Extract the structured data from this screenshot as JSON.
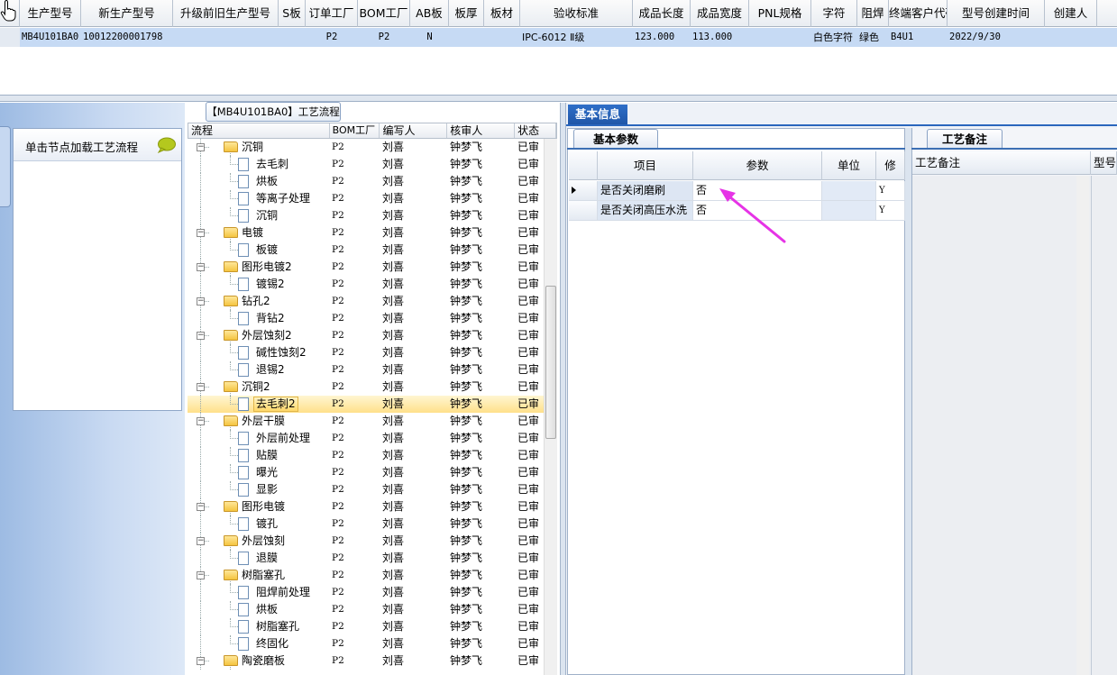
{
  "top_grid": {
    "headers": [
      "生产型号",
      "新生产型号",
      "升级前旧生产型号",
      "S板",
      "订单工厂",
      "BOM工厂",
      "AB板",
      "板厚",
      "板材",
      "验收标准",
      "成品长度",
      "成品宽度",
      "PNL规格",
      "字符",
      "阻焊",
      "终端客户代码",
      "型号创建时间",
      "创建人"
    ],
    "row": [
      "MB4U101BA0",
      "10012200001798",
      "",
      "",
      "P2",
      "P2",
      "N",
      "",
      "",
      "IPC-6012 Ⅱ级",
      "123.000",
      "113.000",
      "",
      "白色字符",
      "绿色",
      "B4U1",
      "2022/9/30",
      ""
    ]
  },
  "left_panel": {
    "node_hint": "单击节点加载工艺流程"
  },
  "flow": {
    "title": "【MB4U101BA0】工艺流程",
    "columns": [
      "流程",
      "BOM工厂",
      "编写人",
      "核审人",
      "状态"
    ],
    "rows": [
      {
        "level": 0,
        "type": "folder",
        "name": "沉铜",
        "bom": "P2",
        "writer": "刘喜",
        "reviewer": "钟梦飞",
        "status": "已审"
      },
      {
        "level": 1,
        "type": "doc",
        "name": "去毛刺",
        "bom": "P2",
        "writer": "刘喜",
        "reviewer": "钟梦飞",
        "status": "已审"
      },
      {
        "level": 1,
        "type": "doc",
        "name": "烘板",
        "bom": "P2",
        "writer": "刘喜",
        "reviewer": "钟梦飞",
        "status": "已审"
      },
      {
        "level": 1,
        "type": "doc",
        "name": "等离子处理",
        "bom": "P2",
        "writer": "刘喜",
        "reviewer": "钟梦飞",
        "status": "已审"
      },
      {
        "level": 1,
        "type": "doc",
        "name": "沉铜",
        "bom": "P2",
        "writer": "刘喜",
        "reviewer": "钟梦飞",
        "status": "已审"
      },
      {
        "level": 0,
        "type": "folder",
        "name": "电镀",
        "bom": "P2",
        "writer": "刘喜",
        "reviewer": "钟梦飞",
        "status": "已审"
      },
      {
        "level": 1,
        "type": "doc",
        "name": "板镀",
        "bom": "P2",
        "writer": "刘喜",
        "reviewer": "钟梦飞",
        "status": "已审"
      },
      {
        "level": 0,
        "type": "folder",
        "name": "图形电镀2",
        "bom": "P2",
        "writer": "刘喜",
        "reviewer": "钟梦飞",
        "status": "已审"
      },
      {
        "level": 1,
        "type": "doc",
        "name": "镀锡2",
        "bom": "P2",
        "writer": "刘喜",
        "reviewer": "钟梦飞",
        "status": "已审"
      },
      {
        "level": 0,
        "type": "folder",
        "name": "钻孔2",
        "bom": "P2",
        "writer": "刘喜",
        "reviewer": "钟梦飞",
        "status": "已审"
      },
      {
        "level": 1,
        "type": "doc",
        "name": "背钻2",
        "bom": "P2",
        "writer": "刘喜",
        "reviewer": "钟梦飞",
        "status": "已审"
      },
      {
        "level": 0,
        "type": "folder",
        "name": "外层蚀刻2",
        "bom": "P2",
        "writer": "刘喜",
        "reviewer": "钟梦飞",
        "status": "已审"
      },
      {
        "level": 1,
        "type": "doc",
        "name": "碱性蚀刻2",
        "bom": "P2",
        "writer": "刘喜",
        "reviewer": "钟梦飞",
        "status": "已审"
      },
      {
        "level": 1,
        "type": "doc",
        "name": "退锡2",
        "bom": "P2",
        "writer": "刘喜",
        "reviewer": "钟梦飞",
        "status": "已审"
      },
      {
        "level": 0,
        "type": "folder",
        "name": "沉铜2",
        "bom": "P2",
        "writer": "刘喜",
        "reviewer": "钟梦飞",
        "status": "已审"
      },
      {
        "level": 1,
        "type": "doc",
        "name": "去毛刺2",
        "bom": "P2",
        "writer": "刘喜",
        "reviewer": "钟梦飞",
        "status": "已审",
        "selected": true
      },
      {
        "level": 0,
        "type": "folder",
        "name": "外层干膜",
        "bom": "P2",
        "writer": "刘喜",
        "reviewer": "钟梦飞",
        "status": "已审"
      },
      {
        "level": 1,
        "type": "doc",
        "name": "外层前处理",
        "bom": "P2",
        "writer": "刘喜",
        "reviewer": "钟梦飞",
        "status": "已审"
      },
      {
        "level": 1,
        "type": "doc",
        "name": "贴膜",
        "bom": "P2",
        "writer": "刘喜",
        "reviewer": "钟梦飞",
        "status": "已审"
      },
      {
        "level": 1,
        "type": "doc",
        "name": "曝光",
        "bom": "P2",
        "writer": "刘喜",
        "reviewer": "钟梦飞",
        "status": "已审"
      },
      {
        "level": 1,
        "type": "doc",
        "name": "显影",
        "bom": "P2",
        "writer": "刘喜",
        "reviewer": "钟梦飞",
        "status": "已审"
      },
      {
        "level": 0,
        "type": "folder",
        "name": "图形电镀",
        "bom": "P2",
        "writer": "刘喜",
        "reviewer": "钟梦飞",
        "status": "已审"
      },
      {
        "level": 1,
        "type": "doc",
        "name": "镀孔",
        "bom": "P2",
        "writer": "刘喜",
        "reviewer": "钟梦飞",
        "status": "已审"
      },
      {
        "level": 0,
        "type": "folder",
        "name": "外层蚀刻",
        "bom": "P2",
        "writer": "刘喜",
        "reviewer": "钟梦飞",
        "status": "已审"
      },
      {
        "level": 1,
        "type": "doc",
        "name": "退膜",
        "bom": "P2",
        "writer": "刘喜",
        "reviewer": "钟梦飞",
        "status": "已审"
      },
      {
        "level": 0,
        "type": "folder",
        "name": "树脂塞孔",
        "bom": "P2",
        "writer": "刘喜",
        "reviewer": "钟梦飞",
        "status": "已审"
      },
      {
        "level": 1,
        "type": "doc",
        "name": "阻焊前处理",
        "bom": "P2",
        "writer": "刘喜",
        "reviewer": "钟梦飞",
        "status": "已审"
      },
      {
        "level": 1,
        "type": "doc",
        "name": "烘板",
        "bom": "P2",
        "writer": "刘喜",
        "reviewer": "钟梦飞",
        "status": "已审"
      },
      {
        "level": 1,
        "type": "doc",
        "name": "树脂塞孔",
        "bom": "P2",
        "writer": "刘喜",
        "reviewer": "钟梦飞",
        "status": "已审"
      },
      {
        "level": 1,
        "type": "doc",
        "name": "终固化",
        "bom": "P2",
        "writer": "刘喜",
        "reviewer": "钟梦飞",
        "status": "已审"
      },
      {
        "level": 0,
        "type": "folder",
        "name": "陶瓷磨板",
        "bom": "P2",
        "writer": "刘喜",
        "reviewer": "钟梦飞",
        "status": "已审"
      }
    ]
  },
  "right_panel": {
    "main_tab": "基本信息",
    "params_tab": "基本参数",
    "params_columns": [
      "项目",
      "参数",
      "单位",
      "修"
    ],
    "params_rows": [
      {
        "item": "是否关闭磨刷",
        "param": "否",
        "unit": "",
        "mod": "Y",
        "current": true
      },
      {
        "item": "是否关闭高压水洗",
        "param": "否",
        "unit": "",
        "mod": "Y",
        "current": false
      }
    ],
    "notes_tab": "工艺备注",
    "notes_columns": [
      "工艺备注",
      "型号"
    ]
  },
  "colors": {
    "selected_row": "#c6daf4",
    "accent_blue": "#1f56a8",
    "tree_selection": "#ffd86a",
    "annotation_arrow": "#e633e6"
  },
  "icons": [
    "hand-pointer-icon",
    "speech-bubble-icon",
    "folder-icon",
    "document-icon",
    "annotation-arrow-icon"
  ]
}
